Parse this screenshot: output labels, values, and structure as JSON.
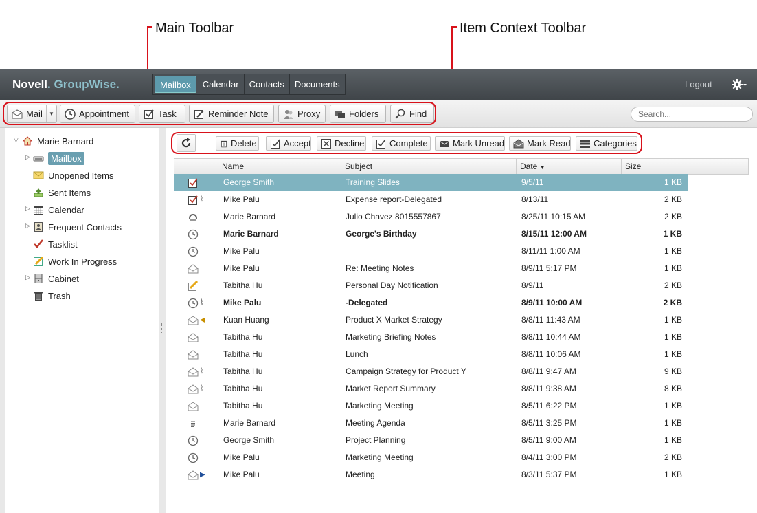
{
  "callouts": {
    "main_toolbar": "Main Toolbar",
    "item_context_toolbar": "Item Context Toolbar"
  },
  "header": {
    "brand_novell": "Novell",
    "brand_groupwise": "GroupWise",
    "tabs": [
      {
        "label": "Mailbox",
        "active": true
      },
      {
        "label": "Calendar",
        "active": false
      },
      {
        "label": "Contacts",
        "active": false
      },
      {
        "label": "Documents",
        "active": false
      }
    ],
    "logout": "Logout",
    "settings_icon": "gear-icon"
  },
  "toolbar": {
    "mail": "Mail",
    "appointment": "Appointment",
    "task": "Task",
    "reminder_note": "Reminder Note",
    "proxy": "Proxy",
    "folders": "Folders",
    "find": "Find",
    "search_placeholder": "Search..."
  },
  "sidebar": {
    "root": "Marie Barnard",
    "items": [
      {
        "label": "Mailbox",
        "icon": "mailbox-icon",
        "selected": true
      },
      {
        "label": "Unopened Items",
        "icon": "envelope-icon"
      },
      {
        "label": "Sent Items",
        "icon": "sent-items-icon"
      },
      {
        "label": "Calendar",
        "icon": "calendar-icon"
      },
      {
        "label": "Frequent Contacts",
        "icon": "contacts-icon"
      },
      {
        "label": "Tasklist",
        "icon": "checkmark-icon"
      },
      {
        "label": "Work In Progress",
        "icon": "pencil-icon"
      },
      {
        "label": "Cabinet",
        "icon": "cabinet-icon"
      },
      {
        "label": "Trash",
        "icon": "trash-icon"
      }
    ]
  },
  "context_toolbar": {
    "delete": "Delete",
    "accept": "Accept",
    "decline": "Decline",
    "complete": "Complete",
    "mark_unread": "Mark Unread",
    "mark_read": "Mark Read",
    "categories": "Categories"
  },
  "grid": {
    "columns": {
      "name": "Name",
      "subject": "Subject",
      "date": "Date",
      "size": "Size"
    },
    "sort_indicator": "descending",
    "rows": [
      {
        "icon": "task-icon",
        "attach": false,
        "name": "George Smith",
        "subject": "Training Slides",
        "date": "9/5/11",
        "size": "1 KB",
        "bold": false,
        "selected": true
      },
      {
        "icon": "task-icon",
        "attach": true,
        "name": "Mike Palu",
        "subject": "Expense report-Delegated",
        "date": "8/13/11",
        "size": "2 KB",
        "bold": false,
        "selected": false
      },
      {
        "icon": "phone-message-icon",
        "attach": false,
        "name": "Marie Barnard",
        "subject": "Julio Chavez 8015557867",
        "date": "8/25/11 10:15 AM",
        "size": "2 KB",
        "bold": false,
        "selected": false
      },
      {
        "icon": "clock-icon",
        "attach": false,
        "name": "Marie Barnard",
        "subject": "George's Birthday",
        "date": "8/15/11 12:00 AM",
        "size": "1 KB",
        "bold": true,
        "selected": false
      },
      {
        "icon": "clock-icon",
        "attach": false,
        "name": "Mike Palu",
        "subject": "",
        "date": "8/11/11 1:00 AM",
        "size": "1 KB",
        "bold": false,
        "selected": false
      },
      {
        "icon": "open-envelope-icon",
        "attach": false,
        "name": "Mike Palu",
        "subject": "Re: Meeting Notes",
        "date": "8/9/11 5:17 PM",
        "size": "1 KB",
        "bold": false,
        "selected": false
      },
      {
        "icon": "note-icon",
        "attach": false,
        "name": "Tabitha Hu",
        "subject": "Personal Day Notification",
        "date": "8/9/11",
        "size": "2 KB",
        "bold": false,
        "selected": false
      },
      {
        "icon": "clock-icon",
        "attach": true,
        "name": "Mike Palu",
        "subject": "-Delegated",
        "date": "8/9/11 10:00 AM",
        "size": "2 KB",
        "bold": true,
        "selected": false
      },
      {
        "icon": "replied-envelope-icon",
        "attach": false,
        "name": "Kuan Huang",
        "subject": "Product X Market Strategy",
        "date": "8/8/11 11:43 AM",
        "size": "1 KB",
        "bold": false,
        "selected": false
      },
      {
        "icon": "open-envelope-icon",
        "attach": false,
        "name": "Tabitha Hu",
        "subject": "Marketing Briefing Notes",
        "date": "8/8/11 10:44 AM",
        "size": "1 KB",
        "bold": false,
        "selected": false
      },
      {
        "icon": "open-envelope-icon",
        "attach": false,
        "name": "Tabitha Hu",
        "subject": "Lunch",
        "date": "8/8/11 10:06 AM",
        "size": "1 KB",
        "bold": false,
        "selected": false
      },
      {
        "icon": "open-envelope-icon",
        "attach": true,
        "name": "Tabitha Hu",
        "subject": "Campaign Strategy for Product Y",
        "date": "8/8/11 9:47 AM",
        "size": "9 KB",
        "bold": false,
        "selected": false
      },
      {
        "icon": "open-envelope-icon",
        "attach": true,
        "name": "Tabitha Hu",
        "subject": "Market Report Summary",
        "date": "8/8/11 9:38 AM",
        "size": "8 KB",
        "bold": false,
        "selected": false
      },
      {
        "icon": "open-envelope-icon",
        "attach": false,
        "name": "Tabitha Hu",
        "subject": "Marketing Meeting",
        "date": "8/5/11 6:22 PM",
        "size": "1 KB",
        "bold": false,
        "selected": false
      },
      {
        "icon": "document-icon",
        "attach": false,
        "name": "Marie Barnard",
        "subject": "Meeting Agenda",
        "date": "8/5/11 3:25 PM",
        "size": "1 KB",
        "bold": false,
        "selected": false
      },
      {
        "icon": "clock-icon",
        "attach": false,
        "name": "George Smith",
        "subject": "Project Planning",
        "date": "8/5/11 9:00 AM",
        "size": "1 KB",
        "bold": false,
        "selected": false
      },
      {
        "icon": "clock-icon",
        "attach": false,
        "name": "Mike Palu",
        "subject": "Marketing Meeting",
        "date": "8/4/11 3:00 PM",
        "size": "2 KB",
        "bold": false,
        "selected": false
      },
      {
        "icon": "forwarded-envelope-icon",
        "attach": false,
        "name": "Mike Palu",
        "subject": "Meeting",
        "date": "8/3/11 5:37 PM",
        "size": "1 KB",
        "bold": false,
        "selected": false
      }
    ]
  }
}
